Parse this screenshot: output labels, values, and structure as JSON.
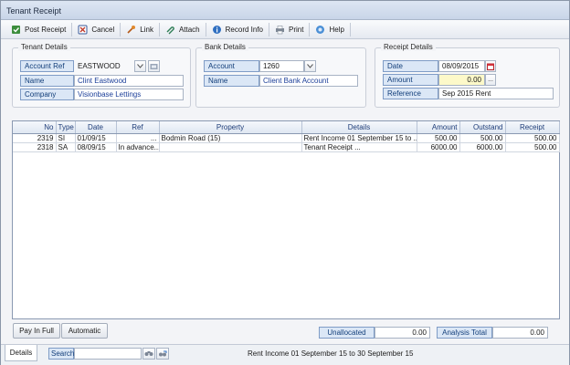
{
  "window": {
    "title": "Tenant Receipt"
  },
  "toolbar": {
    "post_receipt": "Post Receipt",
    "cancel": "Cancel",
    "link": "Link",
    "attach": "Attach",
    "record_info": "Record Info",
    "print": "Print",
    "help": "Help"
  },
  "tenant": {
    "title": "Tenant Details",
    "account_ref_label": "Account Ref",
    "account_ref": "EASTWOOD",
    "name_label": "Name",
    "name": "Clint Eastwood",
    "company_label": "Company",
    "company": "Visionbase Lettings"
  },
  "bank": {
    "title": "Bank Details",
    "account_label": "Account",
    "account": "1260",
    "name_label": "Name",
    "name": "Client Bank Account"
  },
  "receipt": {
    "title": "Receipt Details",
    "date_label": "Date",
    "date": "08/09/2015",
    "amount_label": "Amount",
    "amount": "0.00",
    "reference_label": "Reference",
    "reference": "Sep 2015 Rent"
  },
  "grid": {
    "columns": [
      "No",
      "Type",
      "Date",
      "Ref",
      "Property",
      "Details",
      "Amount",
      "Outstand",
      "Receipt"
    ],
    "rows": [
      {
        "no": "2319",
        "type": "SI",
        "date": "01/09/15",
        "ref": "...",
        "property": "Bodmin Road (15)",
        "details": "Rent Income 01 September 15 to ...",
        "amount": "500.00",
        "outstand": "500.00",
        "receipt": "500.00"
      },
      {
        "no": "2318",
        "type": "SA",
        "date": "08/09/15",
        "ref": "In advance...",
        "property": "",
        "details": "Tenant Receipt ...",
        "amount": "6000.00",
        "outstand": "6000.00",
        "receipt": "500.00"
      }
    ]
  },
  "footer": {
    "pay_in_full": "Pay In Full",
    "automatic": "Automatic",
    "unallocated_label": "Unallocated",
    "unallocated": "0.00",
    "analysis_total_label": "Analysis Total",
    "analysis_total": "0.00"
  },
  "status": {
    "tab_details": "Details",
    "search_label": "Search",
    "search_value": "",
    "message": "Rent Income 01 September 15 to 30 September 15"
  },
  "colors": {
    "label_bg": "#dbe7f6",
    "label_border": "#7f9cc6",
    "value_text": "#1c3f99",
    "amount_bg": "#fdf9c9"
  }
}
